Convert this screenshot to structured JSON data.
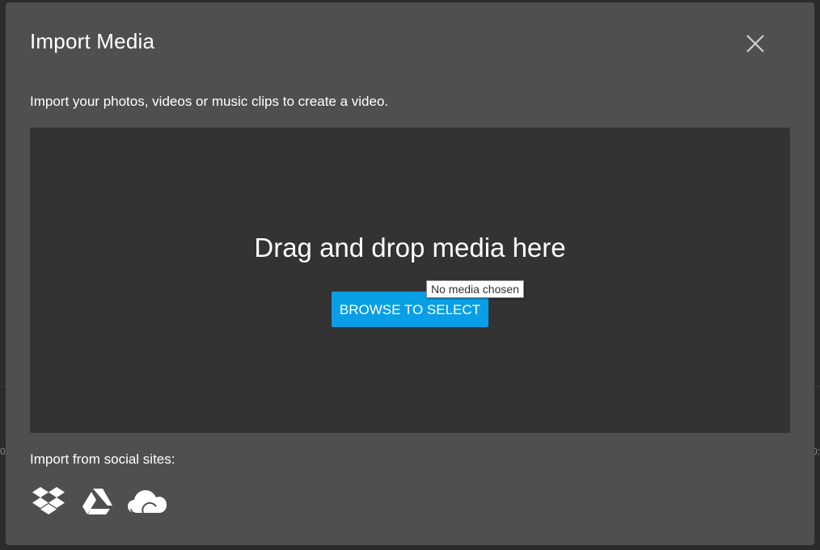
{
  "modal": {
    "title": "Import Media",
    "close_icon": "close-icon",
    "subtitle": "Import your photos, videos or music clips to create a video."
  },
  "dropzone": {
    "prompt": "Drag and drop media here",
    "browse_label": "BROWSE TO SELECT",
    "tooltip": "No media chosen"
  },
  "social": {
    "label": "Import from social sites:",
    "icons": [
      "dropbox-icon",
      "google-drive-icon",
      "onedrive-icon"
    ]
  },
  "backdrop": {
    "left_digit": "0",
    "right_digit": "0:"
  },
  "colors": {
    "modal_bg": "#4f4f4f",
    "dropzone_bg": "#333333",
    "accent": "#0a9ee6",
    "text": "#ffffff"
  }
}
